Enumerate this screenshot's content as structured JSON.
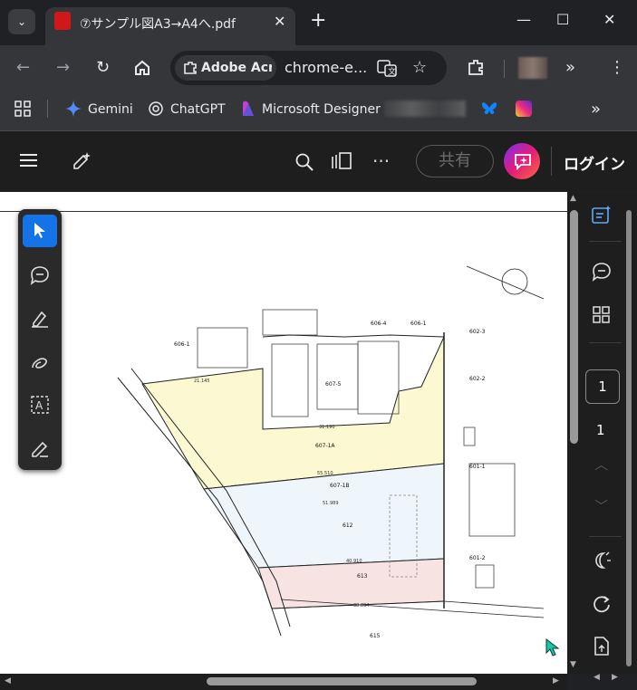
{
  "browser": {
    "tab_title": "⑦サンプル図A3→A4へ.pdf",
    "new_tab_label": "+",
    "omnibox_chip": "Adobe Acrobat",
    "omnibox_url": "chrome-e...",
    "window_controls": [
      "minimize",
      "maximize",
      "close"
    ]
  },
  "bookmarks": [
    {
      "label": "Gemini",
      "icon": "gemini-icon"
    },
    {
      "label": "ChatGPT",
      "icon": "chatgpt-icon"
    },
    {
      "label": "Microsoft Designer",
      "icon": "designer-icon"
    },
    {
      "label": "",
      "icon": "bluesky-icon"
    },
    {
      "label": "",
      "icon": "instagram-icon"
    }
  ],
  "acrobat": {
    "share_label": "共有",
    "login_label": "ログイン",
    "current_page": "1",
    "total_pages": "1"
  },
  "map": {
    "lot_labels": [
      "606-4",
      "606-1",
      "602-3",
      "606-1",
      "602-2",
      "607-5",
      "607-1A",
      "601-1",
      "607-1B",
      "612",
      "601-2",
      "613",
      "615"
    ],
    "lot_colors": {
      "yellow": "#fbf8d2",
      "blue": "#eef6fb",
      "pink": "#f8e3e3"
    },
    "edge_measurements": [
      "21.145",
      "31.190",
      "55.510",
      "51.989",
      "40.910",
      "38.894"
    ]
  }
}
